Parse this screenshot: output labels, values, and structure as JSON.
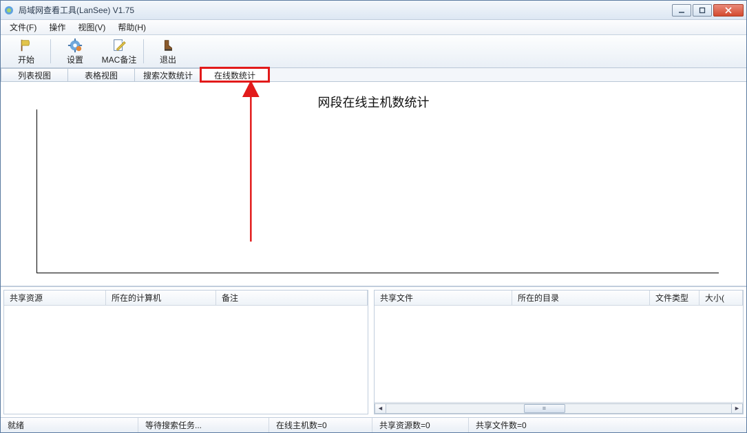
{
  "title": "局域网查看工具(LanSee) V1.75",
  "menu": {
    "file": "文件(F)",
    "operate": "操作",
    "view": "视图(V)",
    "help": "帮助(H)"
  },
  "toolbar": {
    "start": "开始",
    "settings": "设置",
    "macnote": "MAC备注",
    "exit": "退出"
  },
  "tabs": {
    "listview": "列表视图",
    "tableview": "表格视图",
    "searchstat": "搜索次数统计",
    "onlinestat": "在线数统计"
  },
  "active_tab": "onlinestat",
  "chart_data": {
    "type": "line",
    "title": "网段在线主机数统计",
    "xlabel": "",
    "ylabel": "",
    "x": [],
    "series": [],
    "ylim": [
      0,
      1
    ],
    "note": "empty chart — no data displayed"
  },
  "left_panel": {
    "columns": {
      "share_resource": "共享资源",
      "computer": "所在的计算机",
      "note": "备注"
    },
    "rows": []
  },
  "right_panel": {
    "columns": {
      "share_file": "共享文件",
      "directory": "所在的目录",
      "file_type": "文件类型",
      "size": "大小("
    },
    "rows": []
  },
  "status": {
    "ready": "就绪",
    "waiting": "等待搜索任务...",
    "online_hosts": "在线主机数=0",
    "shared_res": "共享资源数=0",
    "shared_files": "共享文件数=0"
  },
  "colors": {
    "annotation": "#e21a1a"
  }
}
